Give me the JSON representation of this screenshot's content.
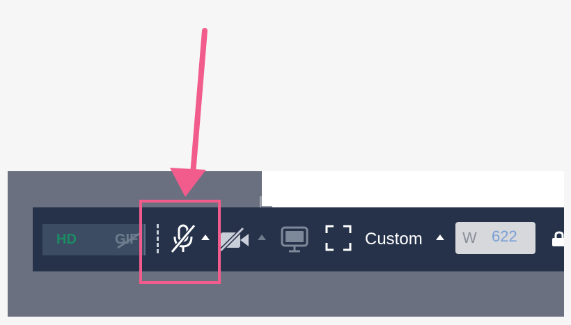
{
  "toolbar": {
    "format": {
      "hd_label": "HD",
      "gif_label": "GIF"
    },
    "mic_button": {
      "icon": "microphone-off-icon",
      "state": "muted"
    },
    "camera_button": {
      "icon": "camera-off-icon",
      "state": "off"
    },
    "screen_button": {
      "icon": "monitor-icon"
    },
    "region_button": {
      "icon": "selection-frame-icon"
    },
    "size_preset": {
      "label": "Custom"
    },
    "width_field": {
      "prefix": "W",
      "value": "622"
    },
    "lock_button": {
      "icon": "lock-icon"
    }
  },
  "annotation": {
    "color": "#f25c8c",
    "arrow_icon": "pointer-arrow-icon",
    "highlight": "mic-button"
  },
  "colors": {
    "toolbar_bg": "#25324a",
    "backdrop": "#6b7080",
    "hd_accent": "#1c8c64",
    "width_value": "#7a9fd6"
  }
}
